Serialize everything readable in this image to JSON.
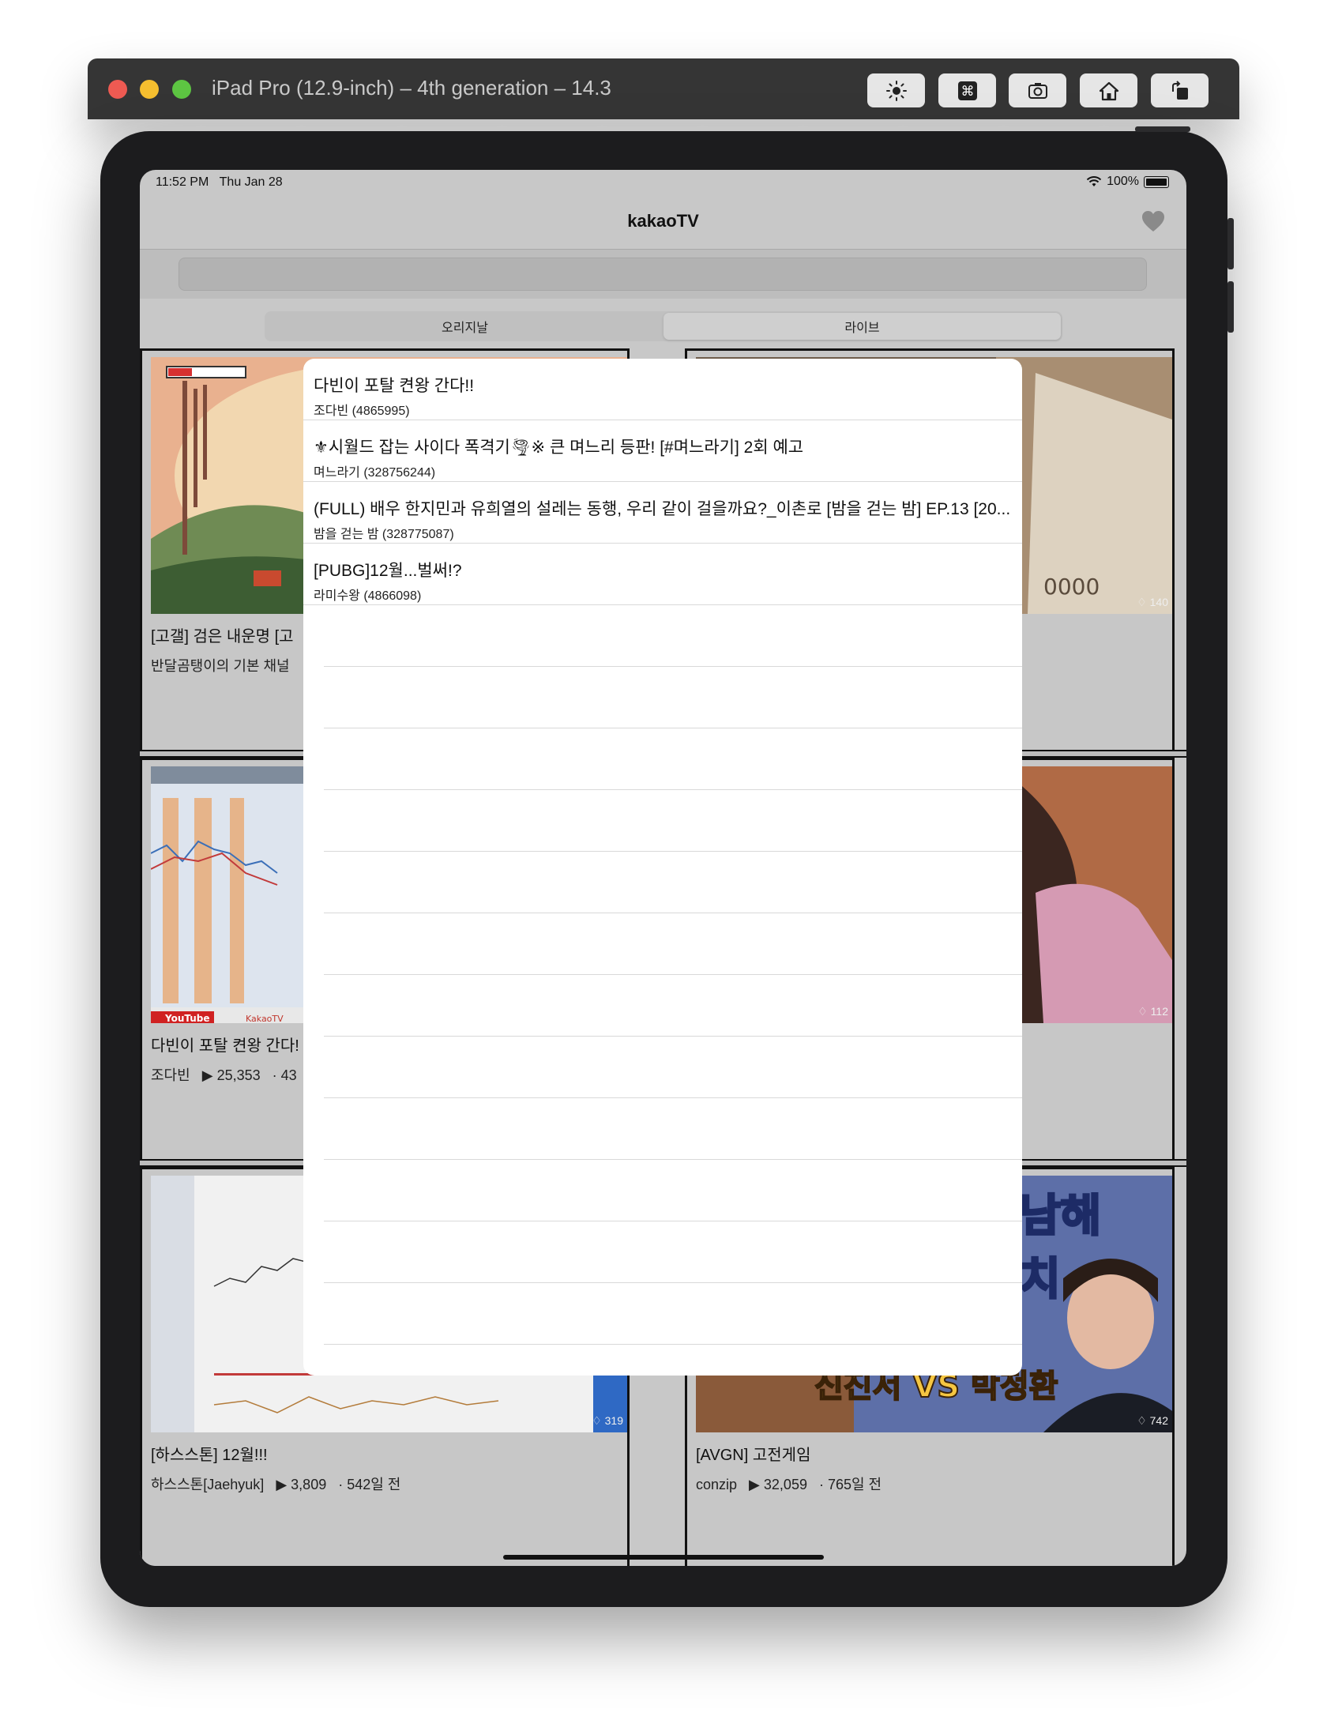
{
  "window": {
    "title": "iPad Pro (12.9-inch) – 4th generation – 14.3",
    "toolbar_icons": [
      "brightness-icon",
      "command-icon",
      "screenshot-icon",
      "home-icon",
      "rotate-icon"
    ]
  },
  "status": {
    "time": "11:52 PM",
    "date": "Thu Jan 28",
    "battery": "100%"
  },
  "nav": {
    "title": "kakaoTV"
  },
  "segments": [
    "오리지날",
    "라이브"
  ],
  "cards": [
    {
      "title": "[고갤] 검은 내운명  [고",
      "channel": "반달곰탱이의 기본 채널",
      "views": "",
      "age": "",
      "duration": ""
    },
    {
      "title": "",
      "channel": "",
      "views": "",
      "age": "",
      "duration": "140"
    },
    {
      "title": "다빈이 포탈 켠왕 간다!",
      "channel": "조다빈",
      "views": "25,353",
      "age": "43",
      "duration": ""
    },
    {
      "title": "",
      "channel": "",
      "views": "",
      "age": "",
      "duration": "112"
    },
    {
      "title": "[하스스톤] 12월!!!",
      "channel": "하스스톤[Jaehyuk]",
      "views": "3,809",
      "age": "542일 전",
      "duration": "319"
    },
    {
      "title": "[AVGN] 고전게임",
      "channel": "conzip",
      "views": "32,059",
      "age": "765일 전",
      "duration": "742"
    }
  ],
  "thumb_texts": {
    "youtube": "YouTube",
    "kakaotv": "KakaoTV",
    "avgn_line1": "남해",
    "avgn_line2": "치",
    "avgn_vs": "신진서 VS 박정환"
  },
  "popover": {
    "items": [
      {
        "title": "다빈이 포탈 켠왕 간다!!",
        "subtitle": "조다빈 (4865995)"
      },
      {
        "title": "⚜시월드 잡는 사이다 폭격기🌪※ 큰 며느리 등판! [#며느라기] 2회 예고",
        "subtitle": "며느라기 (328756244)"
      },
      {
        "title": "(FULL) 배우 한지민과 유희열의 설레는 동행, 우리 같이 걸을까요?_이촌로 [밤을 걷는 밤] EP.13 [20...",
        "subtitle": "밤을 걷는 밤 (328775087)"
      },
      {
        "title": "[PUBG]12월...벌써!?",
        "subtitle": "라미수왕 (4866098)"
      }
    ]
  }
}
